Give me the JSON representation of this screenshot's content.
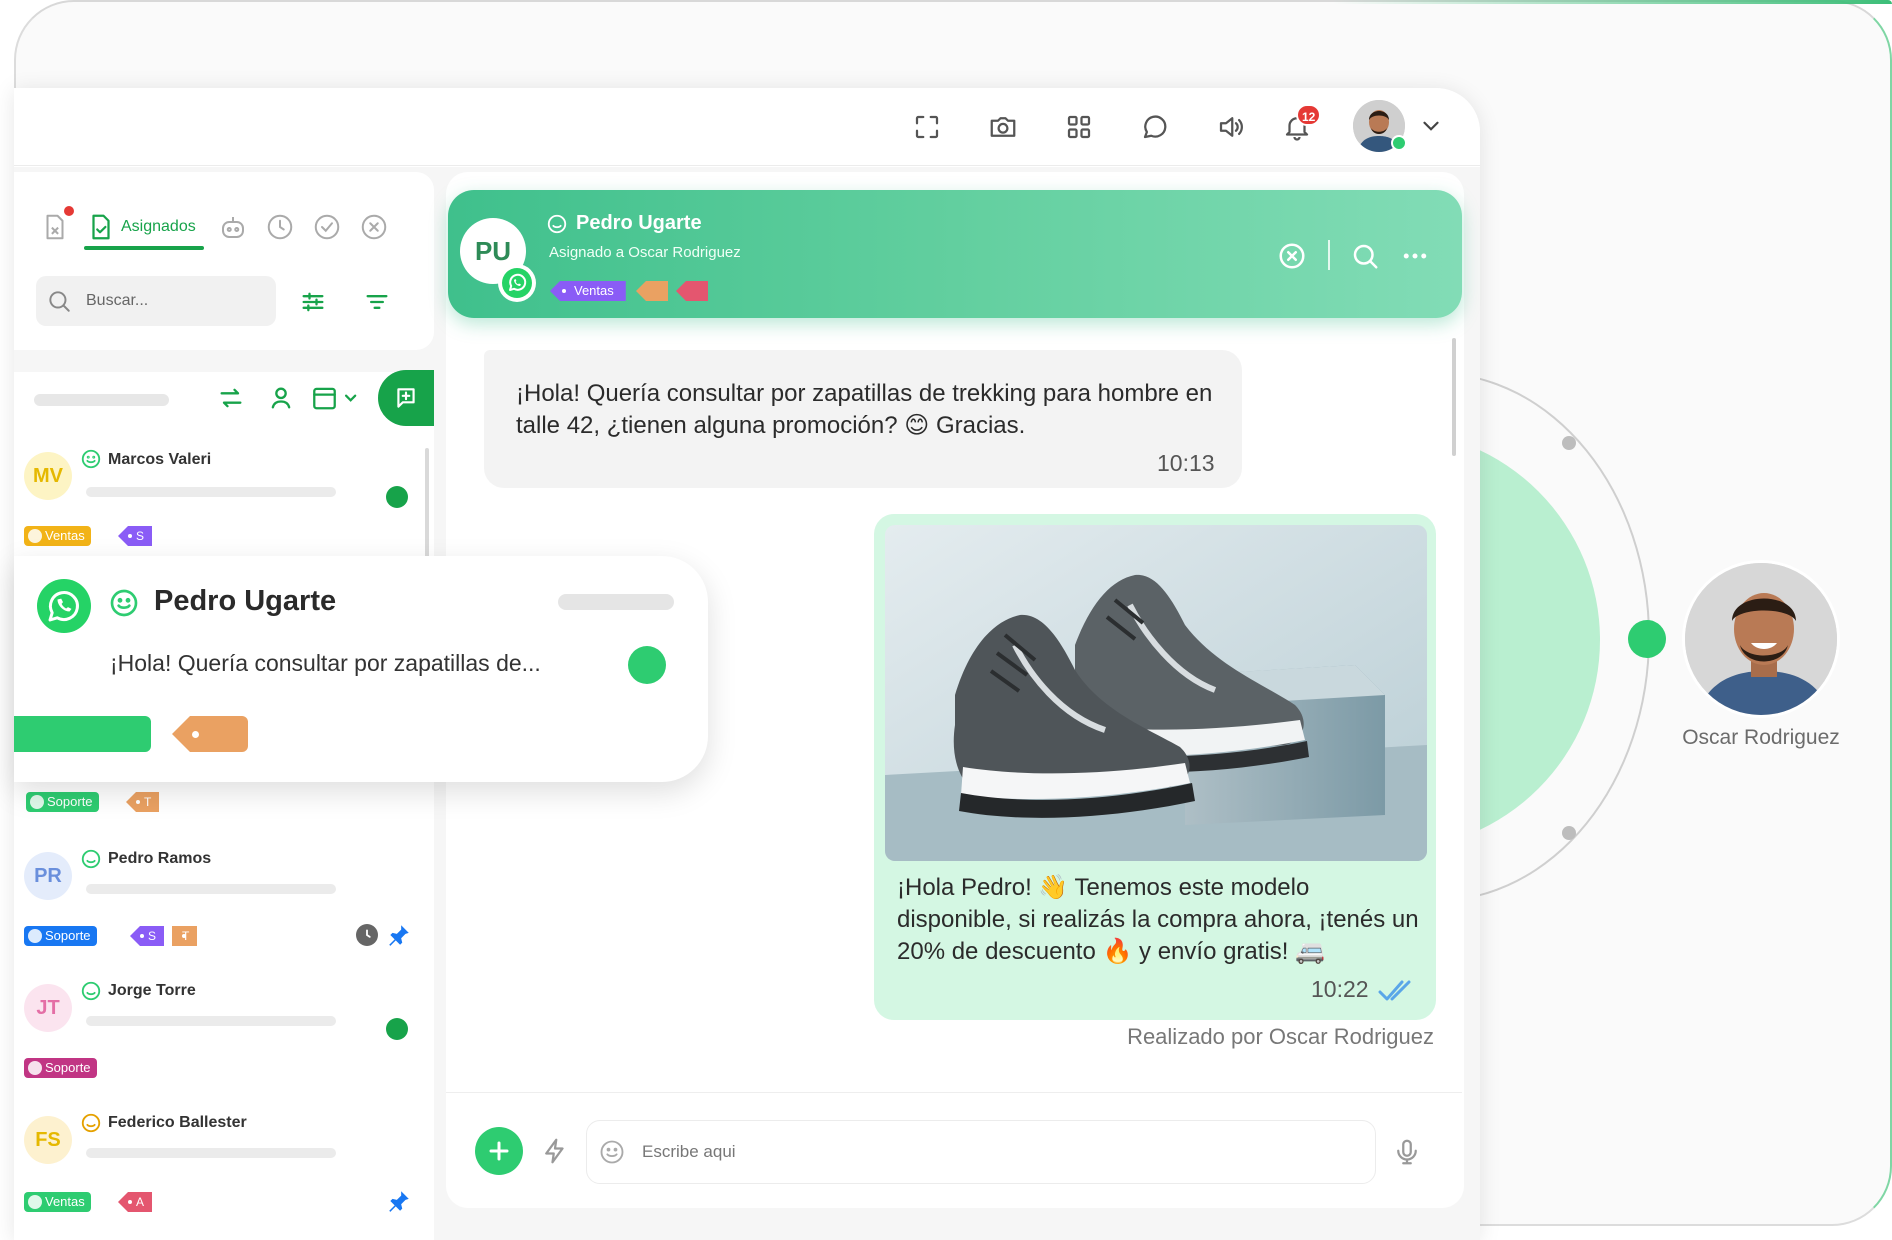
{
  "topbar": {
    "notification_count": "12",
    "icons": [
      "fullscreen-icon",
      "camera-folder-icon",
      "apps-grid-icon",
      "chat-bubble-icon",
      "speaker-icon",
      "bell-icon"
    ]
  },
  "sidebar": {
    "assigned_tab_label": "Asignados",
    "search_placeholder": "Buscar...",
    "conversations": [
      {
        "initials": "MV",
        "name": "Marcos Valeri",
        "pills": [
          {
            "label": "Ventas"
          }
        ],
        "tags": [
          {
            "label": "S"
          }
        ]
      },
      {
        "initials": "PR",
        "name": "Pedro Ramos",
        "pills": [
          {
            "label": "Soporte"
          }
        ],
        "tags": [
          {
            "label": "S"
          },
          {
            "label": "T"
          }
        ]
      },
      {
        "initials": "JT",
        "name": "Jorge Torre",
        "pills": [
          {
            "label": "Soporte"
          }
        ],
        "tags": []
      },
      {
        "initials": "FS",
        "name": "Federico Ballester",
        "pills": [
          {
            "label": "Ventas"
          }
        ],
        "tags": [
          {
            "label": "A"
          }
        ]
      }
    ],
    "hidden_row": {
      "pill": "Soporte",
      "tag": "T"
    }
  },
  "float_card": {
    "name": "Pedro Ugarte",
    "preview": "¡Hola! Quería consultar por zapatillas de..."
  },
  "chat": {
    "header": {
      "initials": "PU",
      "name": "Pedro Ugarte",
      "subtitle": "Asignado a Oscar Rodriguez",
      "tag": "Ventas"
    },
    "messages": [
      {
        "direction": "in",
        "text": "¡Hola! Quería consultar por zapatillas de trekking para hombre en talle 42, ¿tienen alguna promoción? 😊 Gracias.",
        "time": "10:13"
      },
      {
        "direction": "out",
        "text": "¡Hola Pedro! 👋 Tenemos este modelo disponible, si realizás la compra ahora, ¡tenés un 20% de descuento 🔥 y envío gratis! 🚐",
        "time": "10:22",
        "done_by": "Realizado por Oscar Rodriguez"
      }
    ],
    "composer_placeholder": "Escribe aqui"
  },
  "agent": {
    "name": "Oscar Rodriguez"
  },
  "colors": {
    "brand_green": "#17a34a",
    "accent_green": "#2ecc71",
    "header_gradient_start": "#3fc08c",
    "outgoing_bubble": "#d4f7e3",
    "badge_red": "#e53935"
  }
}
